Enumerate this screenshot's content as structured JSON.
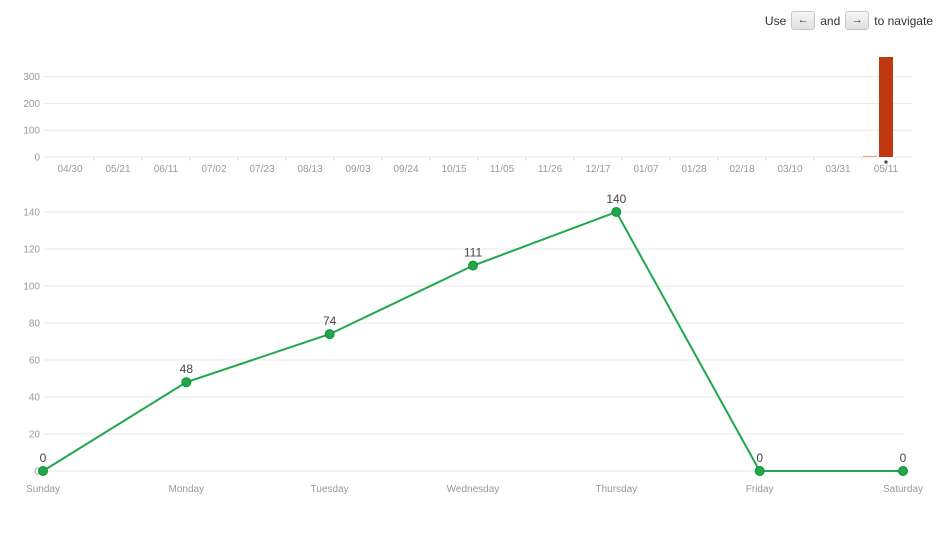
{
  "navigation": {
    "prefix": "Use",
    "left_key": "←",
    "conjunction": "and",
    "right_key": "→",
    "suffix": "to navigate"
  },
  "colors": {
    "bar": "#c0380f",
    "line": "#1ea84a",
    "point": "#1ea84a",
    "grid": "#e8e8e8",
    "tick_text": "#999999"
  },
  "chart_data": [
    {
      "type": "bar",
      "categories": [
        "04/30",
        "05/21",
        "06/11",
        "07/02",
        "07/23",
        "08/13",
        "09/03",
        "09/24",
        "10/15",
        "11/05",
        "11/26",
        "12/17",
        "01/07",
        "01/28",
        "02/18",
        "03/10",
        "03/31",
        "05/11"
      ],
      "series": [
        {
          "values": [
            0,
            0,
            0,
            0,
            0,
            0,
            0,
            0,
            0,
            0,
            0,
            0,
            0,
            0,
            0,
            0,
            0,
            373
          ],
          "extra_small_bar_before_last": 4
        }
      ],
      "yticks": [
        0,
        100,
        200,
        300
      ],
      "ylim": [
        0,
        373
      ],
      "grid": true,
      "marker_under_last_bar": true
    },
    {
      "type": "line",
      "categories": [
        "Sunday",
        "Monday",
        "Tuesday",
        "Wednesday",
        "Thursday",
        "Friday",
        "Saturday"
      ],
      "series": [
        {
          "values": [
            0,
            48,
            74,
            111,
            140,
            0,
            0
          ]
        }
      ],
      "data_labels": [
        "0",
        "48",
        "74",
        "111",
        "140",
        "0",
        "0"
      ],
      "yticks": [
        0,
        20,
        40,
        60,
        80,
        100,
        120,
        140
      ],
      "ylim": [
        0,
        140
      ],
      "grid": true
    }
  ]
}
